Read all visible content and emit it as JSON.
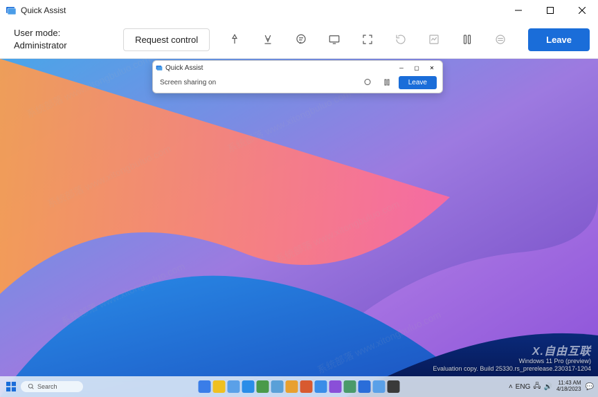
{
  "titlebar": {
    "app_name": "Quick Assist"
  },
  "toolbar": {
    "user_mode_label": "User mode:",
    "user_mode_value": "Administrator",
    "request_control": "Request control",
    "leave": "Leave"
  },
  "remote_notification": {
    "title": "Quick Assist",
    "status": "Screen sharing on",
    "leave": "Leave"
  },
  "remote_taskbar": {
    "search_placeholder": "Search",
    "lang": "ENG",
    "time": "11:43 AM",
    "date": "4/18/2023"
  },
  "watermark": {
    "line1": "Windows 11 Pro (preview)",
    "line2": "Evaluation copy. Build 25330.rs_prerelease.230317-1204"
  },
  "brand_wm": "X.自由互联",
  "diag_wm_text": "系统部落 www.xitongbuluo.com"
}
